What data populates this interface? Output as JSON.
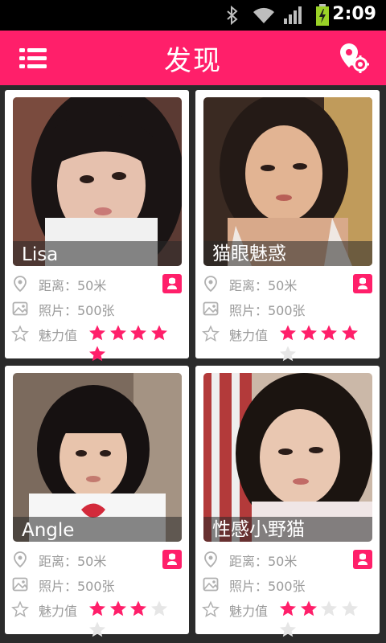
{
  "status_bar": {
    "time": "2:09",
    "icons": [
      "bluetooth-icon",
      "wifi-icon",
      "signal-icon",
      "battery-charging-icon"
    ]
  },
  "app_bar": {
    "title": "发现",
    "left_icon": "menu-list-icon",
    "right_icon": "location-settings-icon"
  },
  "colors": {
    "accent": "#ff1f6a",
    "star_empty": "#e6e6e6",
    "meta_text": "#9a9a9a"
  },
  "cards": [
    {
      "name": "Lisa",
      "distance_label": "距离：50米",
      "photos_label": "照片：500张",
      "charm_label": "魅力值",
      "rating": 5,
      "max_rating": 5
    },
    {
      "name": "猫眼魅惑",
      "distance_label": "距离：50米",
      "photos_label": "照片：500张",
      "charm_label": "魅力值",
      "rating": 4,
      "max_rating": 5
    },
    {
      "name": "Angle",
      "distance_label": "距离：50米",
      "photos_label": "照片：500张",
      "charm_label": "魅力值",
      "rating": 3,
      "max_rating": 5
    },
    {
      "name": "性感小野猫",
      "distance_label": "距离：50米",
      "photos_label": "照片：500张",
      "charm_label": "魅力值",
      "rating": 2,
      "max_rating": 5
    }
  ]
}
